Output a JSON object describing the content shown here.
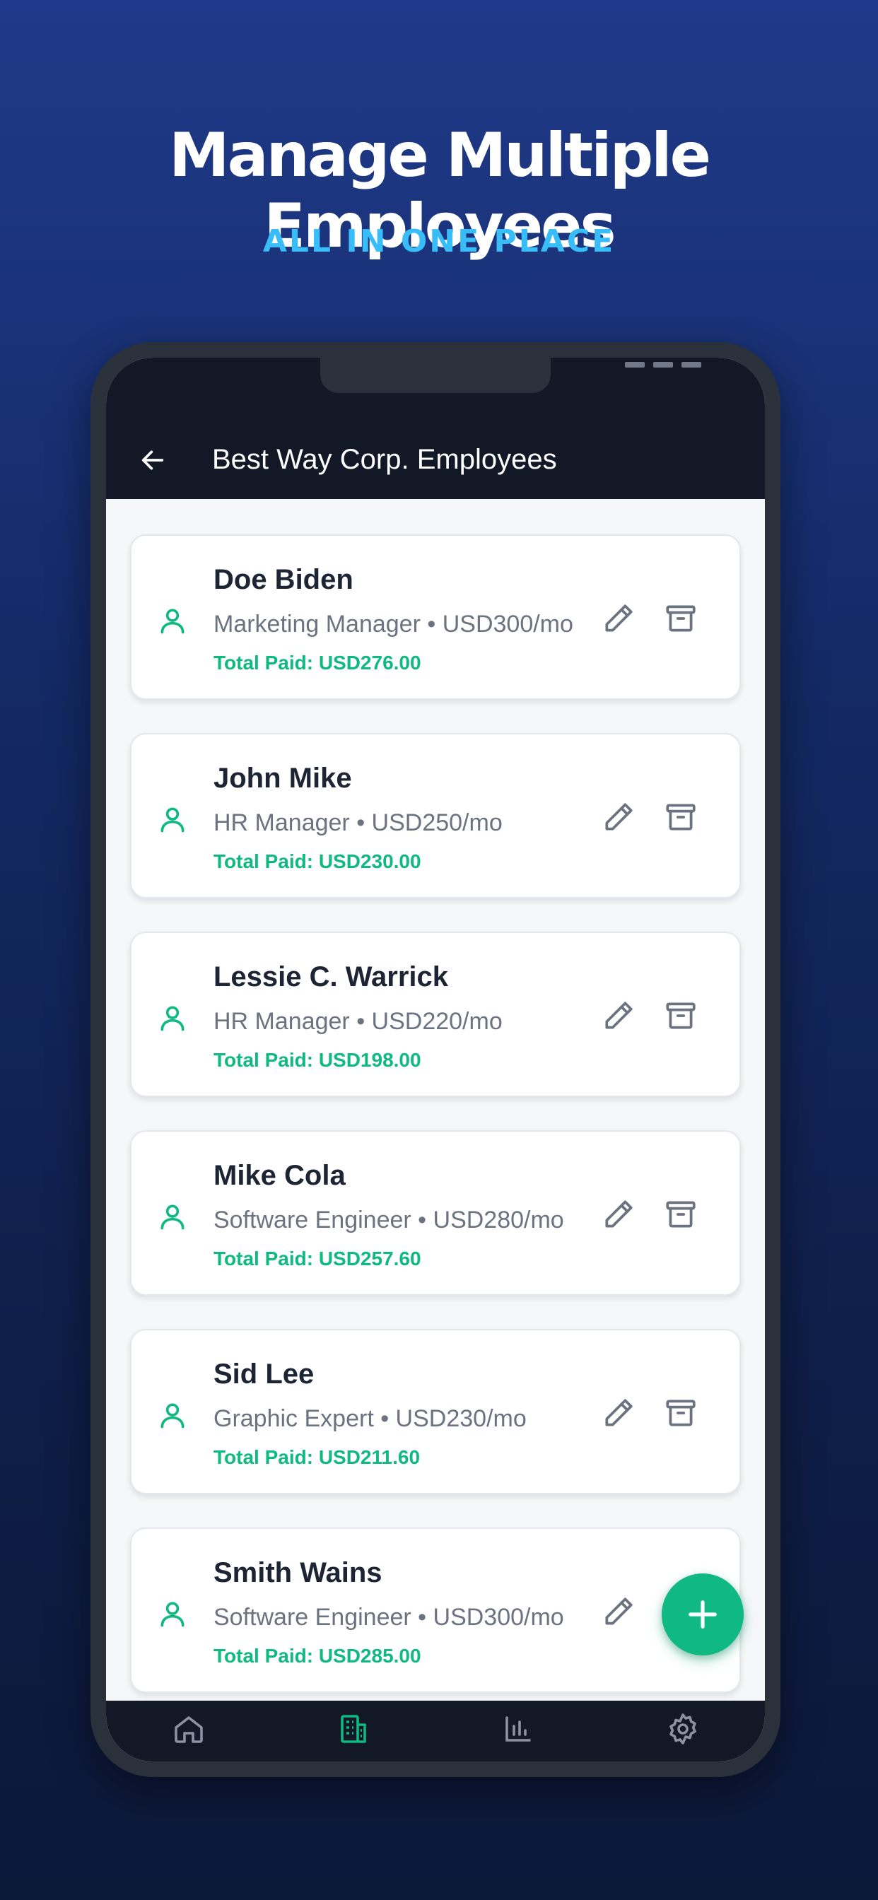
{
  "promo": {
    "headline": "Manage Multiple Employees",
    "subheadline": "ALL IN ONE PLACE"
  },
  "appbar": {
    "title": "Best Way Corp. Employees",
    "back_icon": "arrow-left-icon"
  },
  "employees": [
    {
      "name": "Doe Biden",
      "meta": "Marketing Manager • USD300/mo",
      "paid": "Total Paid: USD276.00"
    },
    {
      "name": "John Mike",
      "meta": "HR Manager • USD250/mo",
      "paid": "Total Paid: USD230.00"
    },
    {
      "name": "Lessie C. Warrick",
      "meta": "HR Manager • USD220/mo",
      "paid": "Total Paid: USD198.00"
    },
    {
      "name": "Mike Cola",
      "meta": "Software Engineer • USD280/mo",
      "paid": "Total Paid: USD257.60"
    },
    {
      "name": "Sid Lee",
      "meta": "Graphic Expert • USD230/mo",
      "paid": "Total Paid: USD211.60"
    },
    {
      "name": "Smith Wains",
      "meta": "Software Engineer • USD300/mo",
      "paid": "Total Paid: USD285.00"
    }
  ],
  "card_icons": {
    "avatar": "user-icon",
    "edit": "pencil-icon",
    "archive": "archive-icon"
  },
  "fab": {
    "icon": "plus-icon"
  },
  "bottom_nav": [
    {
      "icon": "home-icon",
      "active": false
    },
    {
      "icon": "building-icon",
      "active": true
    },
    {
      "icon": "bar-chart-icon",
      "active": false
    },
    {
      "icon": "gear-icon",
      "active": false
    }
  ],
  "colors": {
    "accent": "#10b981",
    "subheadline": "#38bdf8",
    "appbar": "#121826",
    "icon_gray": "#6b7280",
    "nav_inactive": "#8b93a3"
  }
}
